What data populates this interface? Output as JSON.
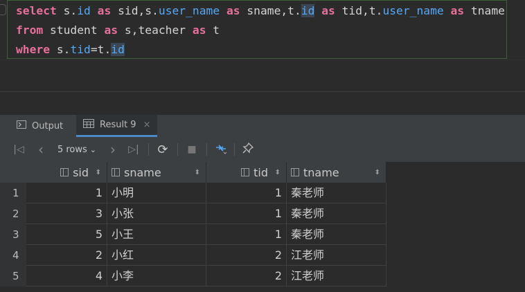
{
  "editor": {
    "line1": [
      {
        "t": "select",
        "c": "kw2"
      },
      {
        "t": " s.",
        "c": "plain"
      },
      {
        "t": "id",
        "c": "fld2"
      },
      {
        "t": " ",
        "c": "plain"
      },
      {
        "t": "as",
        "c": "kw2"
      },
      {
        "t": " sid,s.",
        "c": "plain"
      },
      {
        "t": "user_name",
        "c": "fld2"
      },
      {
        "t": " ",
        "c": "plain"
      },
      {
        "t": "as",
        "c": "kw2"
      },
      {
        "t": " sname,t.",
        "c": "plain"
      },
      {
        "t": "id",
        "c": "fld2 hl"
      },
      {
        "t": " ",
        "c": "plain"
      },
      {
        "t": "as",
        "c": "kw2"
      },
      {
        "t": " tid,t.",
        "c": "plain"
      },
      {
        "t": "user_name",
        "c": "fld2"
      },
      {
        "t": " ",
        "c": "plain"
      },
      {
        "t": "as",
        "c": "kw2"
      },
      {
        "t": " tname",
        "c": "plain"
      }
    ],
    "line2": [
      {
        "t": "from",
        "c": "kw2"
      },
      {
        "t": " student ",
        "c": "plain"
      },
      {
        "t": "as",
        "c": "kw2"
      },
      {
        "t": " s,teacher ",
        "c": "plain"
      },
      {
        "t": "as",
        "c": "kw2"
      },
      {
        "t": " t",
        "c": "plain"
      }
    ],
    "line3": [
      {
        "t": "where",
        "c": "kw2"
      },
      {
        "t": " s.",
        "c": "plain"
      },
      {
        "t": "tid",
        "c": "fld2"
      },
      {
        "t": "=t.",
        "c": "plain"
      },
      {
        "t": "id",
        "c": "fld2 hl"
      }
    ]
  },
  "tabs": {
    "output_label": "Output",
    "result_label": "Result 9",
    "close_glyph": "×"
  },
  "toolbar": {
    "first": "|◁",
    "prev": "‹",
    "rows_label": "5 rows",
    "rows_chevron": "⌄",
    "next": "›",
    "last": "▷|",
    "refresh": "⟳",
    "stop": "■",
    "pin": "📌"
  },
  "grid": {
    "columns": [
      "sid",
      "sname",
      "tid",
      "tname"
    ],
    "rows": [
      {
        "n": "1",
        "sid": "1",
        "sname": "小明",
        "tid": "1",
        "tname": "秦老师"
      },
      {
        "n": "2",
        "sid": "3",
        "sname": "小张",
        "tid": "1",
        "tname": "秦老师"
      },
      {
        "n": "3",
        "sid": "5",
        "sname": "小王",
        "tid": "1",
        "tname": "秦老师"
      },
      {
        "n": "4",
        "sid": "2",
        "sname": "小红",
        "tid": "2",
        "tname": "江老师"
      },
      {
        "n": "5",
        "sid": "4",
        "sname": "小李",
        "tid": "2",
        "tname": "江老师"
      }
    ]
  },
  "colors": {
    "keyword": "#e76f9c",
    "field": "#56a8f5",
    "accent": "#4a88c7"
  }
}
